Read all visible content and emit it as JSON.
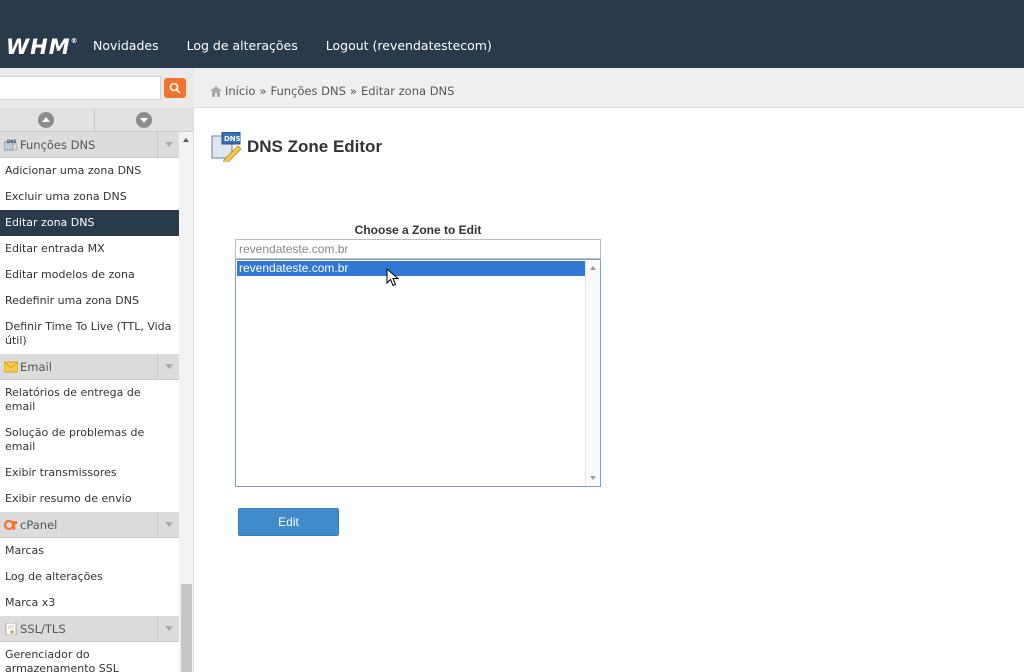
{
  "topbar": {
    "logo": "WHM",
    "logo_mark": "®",
    "nav": [
      {
        "label": "Novidades"
      },
      {
        "label": "Log de alterações"
      },
      {
        "label": "Logout (revendatestecom)"
      }
    ]
  },
  "search": {
    "value": "",
    "placeholder": ""
  },
  "breadcrumb": {
    "items": [
      "Início",
      "Funções DNS",
      "Editar zona DNS"
    ],
    "separator": "»"
  },
  "sidebar": {
    "groups": [
      {
        "title": "Funções DNS",
        "icon": "dns-icon",
        "items": [
          {
            "label": "Adicionar uma zona DNS"
          },
          {
            "label": "Excluir uma zona DNS"
          },
          {
            "label": "Editar zona DNS",
            "active": true
          },
          {
            "label": "Editar entrada MX"
          },
          {
            "label": "Editar modelos de zona"
          },
          {
            "label": "Redefinir uma zona DNS"
          },
          {
            "label": "Definir Time To Live (TTL, Vida útil)"
          }
        ]
      },
      {
        "title": "Email",
        "icon": "envelope-icon",
        "items": [
          {
            "label": "Relatórios de entrega de email"
          },
          {
            "label": "Solução de problemas de email"
          },
          {
            "label": "Exibir transmissores"
          },
          {
            "label": "Exibir resumo de envio"
          }
        ]
      },
      {
        "title": "cPanel",
        "icon": "cpanel-icon",
        "items": [
          {
            "label": "Marcas"
          },
          {
            "label": "Log de alterações"
          },
          {
            "label": "Marca x3"
          }
        ]
      },
      {
        "title": "SSL/TLS",
        "icon": "certificate-icon",
        "items": [
          {
            "label": "Gerenciador do armazenamento SSL"
          }
        ]
      }
    ]
  },
  "main": {
    "title": "DNS Zone Editor",
    "icon_text": "DNS",
    "zone_label": "Choose a Zone to Edit",
    "zone_filter": {
      "value": "revendateste.com.br"
    },
    "zones": [
      "revendateste.com.br"
    ],
    "selected_zone": "revendateste.com.br",
    "edit_button": "Edit"
  },
  "colors": {
    "topbar": "#293a4a",
    "accent_orange": "#f0742f",
    "selection": "#3178d6",
    "button": "#428bca"
  }
}
